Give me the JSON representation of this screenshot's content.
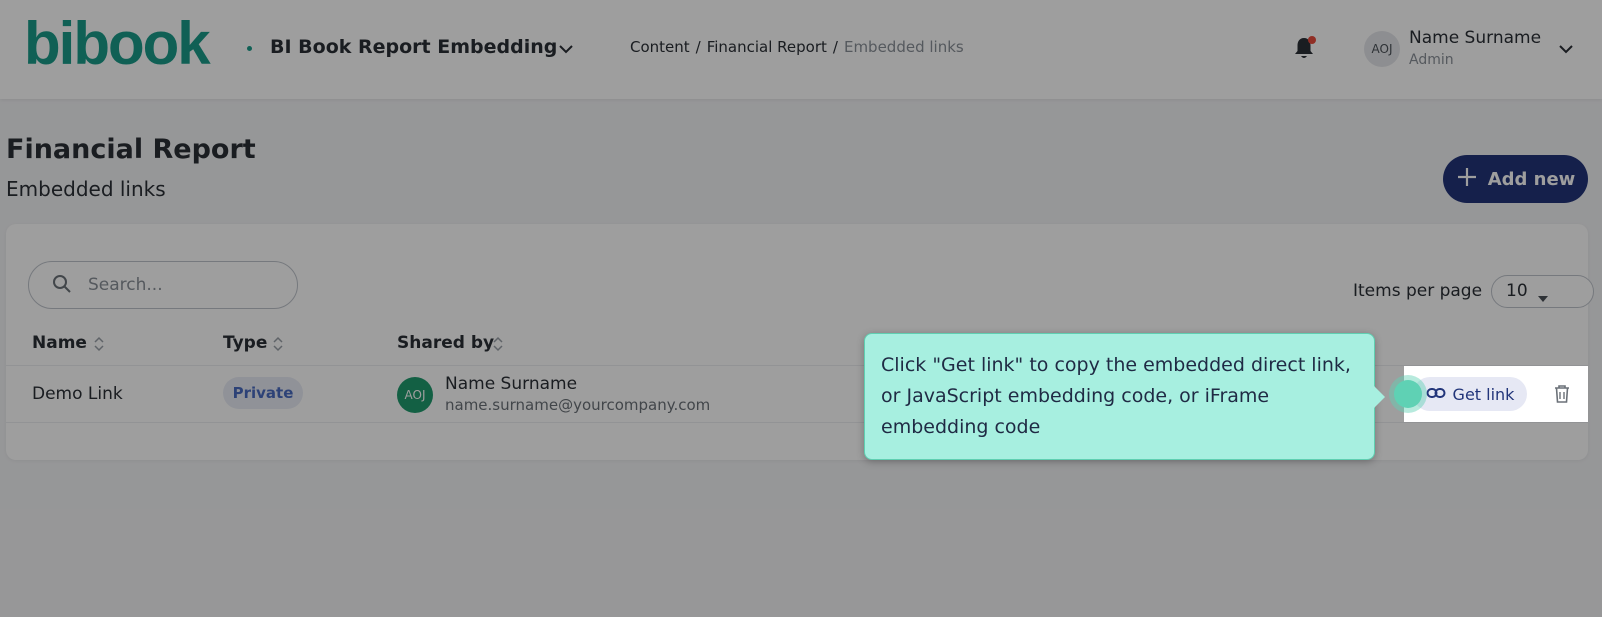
{
  "header": {
    "logo_text": "bibook",
    "app_title": "BI Book Report Embedding",
    "breadcrumb": [
      "Content",
      "Financial Report",
      "Embedded links"
    ],
    "user": {
      "initials": "AOJ",
      "name": "Name Surname",
      "role": "Admin"
    }
  },
  "page": {
    "title": "Financial Report",
    "subtitle": "Embedded links",
    "add_button_label": "Add new"
  },
  "toolbar": {
    "search_placeholder": "Search...",
    "items_per_page_label": "Items per page",
    "items_per_page_value": "10"
  },
  "table": {
    "columns": [
      "Name",
      "Type",
      "Shared by"
    ],
    "rows": [
      {
        "name": "Demo Link",
        "type": "Private",
        "shared_by": {
          "initials": "AOJ",
          "name": "Name Surname",
          "email": "name.surname@yourcompany.com"
        },
        "action_label": "Get link"
      }
    ]
  },
  "tooltip": {
    "text": "Click \"Get link\" to copy the embedded direct link, or JavaScript embedding code, or iFrame embedding code"
  },
  "colors": {
    "brand": "#1a9c8a",
    "primary": "#22357a",
    "tooltip_bg": "#a7efe0",
    "notification_dot": "#e94b3c"
  },
  "icons": [
    "chevron-down-icon",
    "bell-icon",
    "plus-icon",
    "search-icon",
    "caret-down-icon",
    "sort-icon",
    "link-icon",
    "trash-icon"
  ]
}
